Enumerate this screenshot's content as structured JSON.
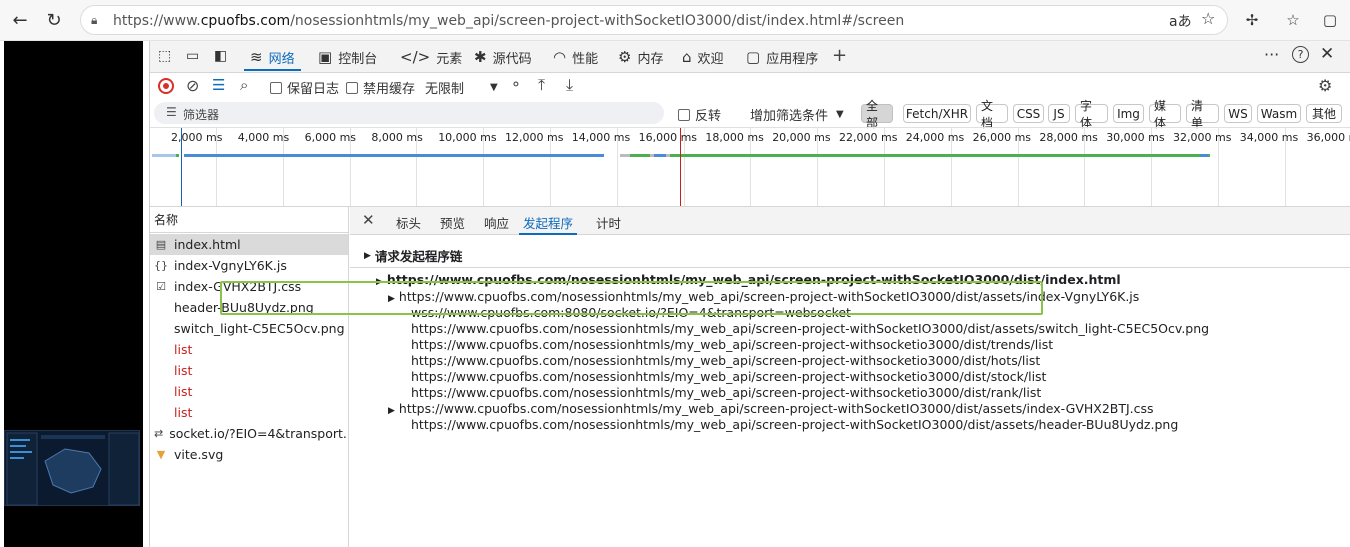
{
  "browser": {
    "url_prefix": "https://www.",
    "url_domain": "cpuofbs.com",
    "url_path": "/nosessionhtmls/my_web_api/screen-project-withSocketIO3000/dist/index.html#/screen",
    "read_aloud": "aあ"
  },
  "devtools": {
    "tabs": [
      {
        "label": "网络",
        "icon": "wifi-icon"
      },
      {
        "label": "控制台",
        "icon": "console-icon"
      },
      {
        "label": "元素",
        "icon": "code-icon"
      },
      {
        "label": "源代码",
        "icon": "bug-icon"
      },
      {
        "label": "性能",
        "icon": "gauge-icon"
      },
      {
        "label": "内存",
        "icon": "chip-icon"
      },
      {
        "label": "欢迎",
        "icon": "home-icon"
      },
      {
        "label": "应用程序",
        "icon": "app-icon"
      }
    ],
    "toolbar": {
      "preserve_log": "保留日志",
      "disable_cache": "禁用缓存",
      "throttle": "无限制"
    },
    "filter": {
      "placeholder": "筛选器",
      "invert": "反转",
      "more_filters": "增加筛选条件",
      "types": [
        "全部",
        "Fetch/XHR",
        "文档",
        "CSS",
        "JS",
        "字体",
        "Img",
        "媒体",
        "清单",
        "WS",
        "Wasm",
        "其他"
      ]
    },
    "timeline_ticks": [
      "2,000 ms",
      "4,000 ms",
      "6,000 ms",
      "8,000 ms",
      "10,000 ms",
      "12,000 ms",
      "14,000 ms",
      "16,000 ms",
      "18,000 ms",
      "20,000 ms",
      "22,000 ms",
      "24,000 ms",
      "26,000 ms",
      "28,000 ms",
      "30,000 ms",
      "32,000 ms",
      "34,000 ms",
      "36,000 ms"
    ],
    "name_header": "名称",
    "requests": [
      {
        "name": "index.html",
        "icon": "doc-icon",
        "selected": true,
        "error": false
      },
      {
        "name": "index-VgnyLY6K.js",
        "icon": "script-icon",
        "selected": false,
        "error": false
      },
      {
        "name": "index-GVHX2BTJ.css",
        "icon": "css-icon",
        "selected": false,
        "error": false
      },
      {
        "name": "header-BUu8Uydz.png",
        "icon": "",
        "selected": false,
        "error": false
      },
      {
        "name": "switch_light-C5EC5Ocv.png",
        "icon": "",
        "selected": false,
        "error": false
      },
      {
        "name": "list",
        "icon": "",
        "selected": false,
        "error": true
      },
      {
        "name": "list",
        "icon": "",
        "selected": false,
        "error": true
      },
      {
        "name": "list",
        "icon": "",
        "selected": false,
        "error": true
      },
      {
        "name": "list",
        "icon": "",
        "selected": false,
        "error": true
      },
      {
        "name": "socket.io/?EIO=4&transport...",
        "icon": "websocket-icon",
        "selected": false,
        "error": false
      },
      {
        "name": "vite.svg",
        "icon": "vite-icon",
        "selected": false,
        "error": false
      }
    ],
    "detail_tabs": [
      "标头",
      "预览",
      "响应",
      "发起程序",
      "计时"
    ],
    "active_detail_tab": "发起程序",
    "initiator": {
      "section_title": "请求发起程序链",
      "root": "https://www.cpuofbs.com/nosessionhtmls/my_web_api/screen-project-withSocketIO3000/dist/index.html",
      "lines": [
        "https://www.cpuofbs.com/nosessionhtmls/my_web_api/screen-project-withSocketIO3000/dist/assets/index-VgnyLY6K.js",
        "wss://www.cpuofbs.com:8080/socket.io/?EIO=4&transport=websocket",
        "https://www.cpuofbs.com/nosessionhtmls/my_web_api/screen-project-withSocketIO3000/dist/assets/switch_light-C5EC5Ocv.png",
        "https://www.cpuofbs.com/nosessionhtmls/my_web_api/screen-project-withsocketio3000/dist/trends/list",
        "https://www.cpuofbs.com/nosessionhtmls/my_web_api/screen-project-withsocketio3000/dist/hots/list",
        "https://www.cpuofbs.com/nosessionhtmls/my_web_api/screen-project-withsocketio3000/dist/stock/list",
        "https://www.cpuofbs.com/nosessionhtmls/my_web_api/screen-project-withsocketio3000/dist/rank/list",
        "https://www.cpuofbs.com/nosessionhtmls/my_web_api/screen-project-withSocketIO3000/dist/assets/index-GVHX2BTJ.css",
        "https://www.cpuofbs.com/nosessionhtmls/my_web_api/screen-project-withSocketIO3000/dist/assets/header-BUu8Uydz.png"
      ]
    }
  }
}
